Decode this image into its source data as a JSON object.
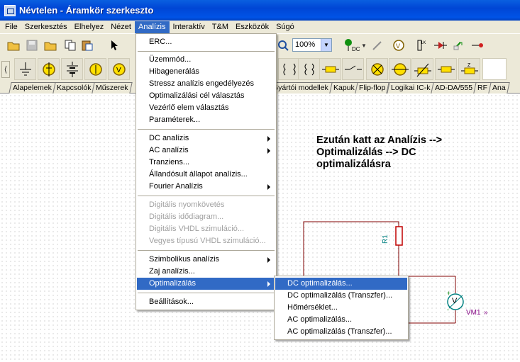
{
  "window": {
    "title": "Névtelen - Áramkör szerkeszto"
  },
  "menubar": [
    {
      "label": "File"
    },
    {
      "label": "Szerkesztés"
    },
    {
      "label": "Elhelyez"
    },
    {
      "label": "Nézet"
    },
    {
      "label": "Analízis"
    },
    {
      "label": "Interaktív"
    },
    {
      "label": "T&M"
    },
    {
      "label": "Eszközök"
    },
    {
      "label": "Súgó"
    }
  ],
  "toolbar": {
    "zoom": "100%",
    "dc_label": "DC"
  },
  "tabs": [
    {
      "label": "Alapelemek"
    },
    {
      "label": "Kapcsolók"
    },
    {
      "label": "Műszerek"
    },
    {
      "label": "Gyártói modellek"
    },
    {
      "label": "Kapuk"
    },
    {
      "label": "Flip-flop"
    },
    {
      "label": "Logikai IC-k"
    },
    {
      "label": "AD-DA/555"
    },
    {
      "label": "RF"
    },
    {
      "label": "Ana"
    }
  ],
  "analysis_menu": [
    {
      "label": "ERC...",
      "enabled": true
    },
    {
      "label": "Üzemmód...",
      "enabled": true
    },
    {
      "label": "Hibagenerálás",
      "enabled": true
    },
    {
      "label": "Stressz analízis engedélyezés",
      "enabled": true
    },
    {
      "label": "Optimalizálási cél választás",
      "enabled": true
    },
    {
      "label": "Vezérlő elem választás",
      "enabled": true
    },
    {
      "label": "Paraméterek...",
      "enabled": true
    },
    {
      "label": "DC analízis",
      "enabled": true,
      "submenu": true
    },
    {
      "label": "AC analízis",
      "enabled": true,
      "submenu": true
    },
    {
      "label": "Tranziens...",
      "enabled": true
    },
    {
      "label": "Állandósult állapot analízis...",
      "enabled": true
    },
    {
      "label": "Fourier Analízis",
      "enabled": true,
      "submenu": true
    },
    {
      "label": "Digitális nyomkövetés",
      "enabled": false
    },
    {
      "label": "Digitális idődiagram...",
      "enabled": false
    },
    {
      "label": "Digitális VHDL szimuláció...",
      "enabled": false
    },
    {
      "label": "Vegyes típusú VHDL szimuláció...",
      "enabled": false
    },
    {
      "label": "Szimbolikus analízis",
      "enabled": true,
      "submenu": true
    },
    {
      "label": "Zaj analízis...",
      "enabled": true
    },
    {
      "label": "Optimalizálás",
      "enabled": true,
      "submenu": true,
      "highlighted": true
    },
    {
      "label": "Beállítások...",
      "enabled": true
    }
  ],
  "optimization_submenu": [
    {
      "label": "DC optimalizálás...",
      "highlighted": true
    },
    {
      "label": "DC optimalizálás (Transzfer)..."
    },
    {
      "label": "Hőmérséklet..."
    },
    {
      "label": "AC optimalizálás..."
    },
    {
      "label": "AC optimalizálás (Transzfer)..."
    }
  ],
  "annotation": {
    "text": "Ezután katt az Analízis --> Optimalizálás --> DC optimalizálásra"
  },
  "circuit": {
    "resistor_label": "R1",
    "meter_label": "VM1",
    "meter_symbol": "V",
    "plus": "+",
    "minus": "-",
    "arrow": "»"
  },
  "colors": {
    "accent": "#316ac5",
    "wire": "#800000",
    "titlebar": "#0054e3"
  }
}
